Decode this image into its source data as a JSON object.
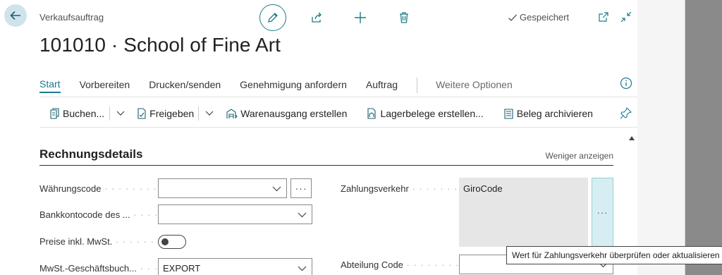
{
  "header": {
    "breadcrumb": "Verkaufsauftrag",
    "saved_status": "Gespeichert",
    "title": "101010 · School of Fine Art",
    "icons": [
      "back-arrow-icon",
      "pencil-icon",
      "share-icon",
      "plus-icon",
      "trash-icon",
      "checkmark-icon",
      "open-new-window-icon",
      "collapse-icon"
    ]
  },
  "menu": {
    "items": [
      "Start",
      "Vorbereiten",
      "Drucken/senden",
      "Genehmigung anfordern",
      "Auftrag"
    ],
    "active": "Start",
    "more": "Weitere Optionen"
  },
  "actions": {
    "post": "Buchen...",
    "release": "Freigeben",
    "create_shipment": "Warenausgang erstellen",
    "create_warehouse_docs": "Lagerbelege erstellen...",
    "archive": "Beleg archivieren"
  },
  "section": {
    "title": "Rechnungsdetails",
    "toggle_less": "Weniger anzeigen"
  },
  "fields": {
    "currency_code": {
      "label": "Währungscode",
      "value": ""
    },
    "bank_account_code": {
      "label": "Bankkontocode des ...",
      "value": ""
    },
    "prices_incl_vat": {
      "label": "Preise inkl. MwSt.",
      "value": "off"
    },
    "vat_bus_posting": {
      "label": "MwSt.-Geschäftsbuch...",
      "value": "EXPORT"
    },
    "payment_reference": {
      "label": "Zahlungsverkehr",
      "value": "GiroCode"
    },
    "department_code": {
      "label": "Abteilung Code",
      "value": ""
    }
  },
  "ellipsis": "···",
  "tooltip": "Wert für Zahlungsverkehr überprüfen oder aktualisieren",
  "colors": {
    "accent": "#1c7a8a",
    "assist_bg": "#d6eef2"
  }
}
